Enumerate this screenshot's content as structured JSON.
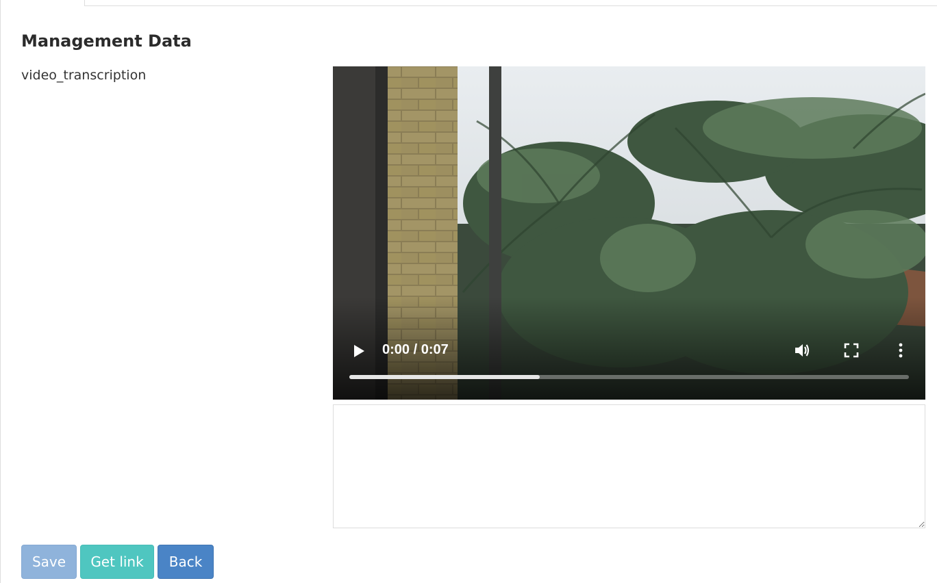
{
  "page": {
    "section_title": "Management Data",
    "field_label": "video_transcription"
  },
  "video": {
    "current_time": "0:00",
    "duration": "0:07",
    "time_display": "0:00 / 0:07",
    "progress_fraction": 0.34,
    "icons": {
      "play": "play-icon",
      "volume": "volume-icon",
      "fullscreen": "fullscreen-icon",
      "more": "more-options-icon"
    }
  },
  "transcription": {
    "value": "",
    "placeholder": ""
  },
  "buttons": {
    "save_label": "Save",
    "get_link_label": "Get link",
    "back_label": "Back"
  },
  "colors": {
    "save": "#8fb3db",
    "get_link": "#4fc6c0",
    "back": "#4a84c6"
  }
}
